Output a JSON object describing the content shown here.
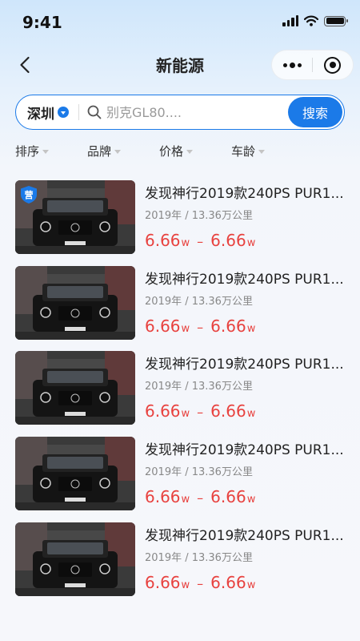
{
  "status_bar": {
    "time": "9:41",
    "icons": [
      "signal-icon",
      "wifi-icon",
      "battery-icon"
    ]
  },
  "nav": {
    "title": "新能源",
    "icons": [
      "chevron-left-icon",
      "more-dots-icon",
      "target-icon"
    ]
  },
  "search": {
    "city": "深圳",
    "placeholder": "别克GL80....",
    "button_label": "搜索"
  },
  "filters": [
    {
      "label": "排序"
    },
    {
      "label": "品牌"
    },
    {
      "label": "价格"
    },
    {
      "label": "车龄"
    }
  ],
  "cars": [
    {
      "title": "发现神行2019款240PS PUR1...",
      "meta": "2019年 / 13.36万公里",
      "price_low": "6.66",
      "price_high": "6.66",
      "unit": "w",
      "sep": "–",
      "badge": "营"
    },
    {
      "title": "发现神行2019款240PS PUR1...",
      "meta": "2019年 / 13.36万公里",
      "price_low": "6.66",
      "price_high": "6.66",
      "unit": "w",
      "sep": "–",
      "badge": ""
    },
    {
      "title": "发现神行2019款240PS PUR1...",
      "meta": "2019年 / 13.36万公里",
      "price_low": "6.66",
      "price_high": "6.66",
      "unit": "w",
      "sep": "–",
      "badge": ""
    },
    {
      "title": "发现神行2019款240PS PUR1...",
      "meta": "2019年 / 13.36万公里",
      "price_low": "6.66",
      "price_high": "6.66",
      "unit": "w",
      "sep": "–",
      "badge": ""
    },
    {
      "title": "发现神行2019款240PS PUR1...",
      "meta": "2019年 / 13.36万公里",
      "price_low": "6.66",
      "price_high": "6.66",
      "unit": "w",
      "sep": "–",
      "badge": ""
    }
  ],
  "colors": {
    "accent": "#1b7ae8",
    "price": "#e8423f",
    "background": "#f6f7fb"
  }
}
